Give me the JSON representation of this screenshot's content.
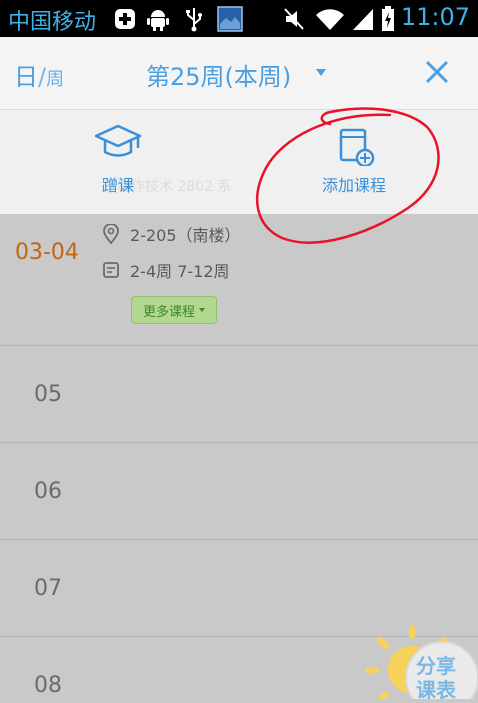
{
  "status_bar": {
    "carrier": "中国移动",
    "time": "11:07",
    "icons": [
      "plus-notification-icon",
      "android-debug-icon",
      "usb-icon",
      "image-notification-icon",
      "mute-icon",
      "wifi-icon",
      "signal-icon",
      "battery-charging-icon"
    ]
  },
  "header": {
    "view_day": "日",
    "view_week": "周",
    "week_title": "第25周(本周)",
    "close_icon": "close-icon"
  },
  "actions": {
    "gift_course": "蹭课",
    "add_course": "添加课程",
    "faded_text": "制作技术 2802 系"
  },
  "schedule": {
    "rows": [
      {
        "label": "03-04",
        "location": "2-205（南楼）",
        "weeks": "2-4周 7-12周",
        "more": "更多课程"
      },
      {
        "label": "05"
      },
      {
        "label": "06"
      },
      {
        "label": "07"
      },
      {
        "label": "08"
      }
    ]
  },
  "logo": {
    "line1": "分享",
    "line2": "课表"
  },
  "colors": {
    "accent": "#4a9fe0",
    "period": "#c2650f",
    "annotation": "#e8132a",
    "more_button": "#b3d690"
  }
}
